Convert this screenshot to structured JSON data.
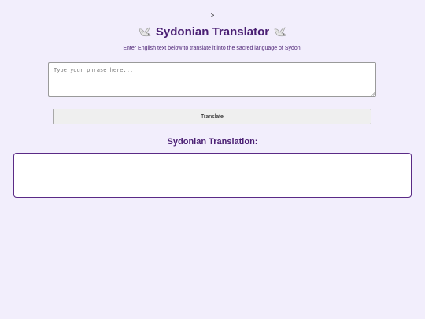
{
  "stray_text": ">",
  "header": {
    "title": "Sydonian Translator",
    "left_icon": "dove-icon",
    "right_icon": "dove-icon",
    "subtitle": "Enter English text below to translate it into the sacred language of Sydon."
  },
  "input": {
    "placeholder": "Type your phrase here...",
    "value": ""
  },
  "translate_button": {
    "label": "Translate"
  },
  "output": {
    "heading": "Sydonian Translation:",
    "text": ""
  },
  "colors": {
    "background": "#f2eefc",
    "accent": "#4a1f73",
    "output_border": "#5a2a86"
  }
}
